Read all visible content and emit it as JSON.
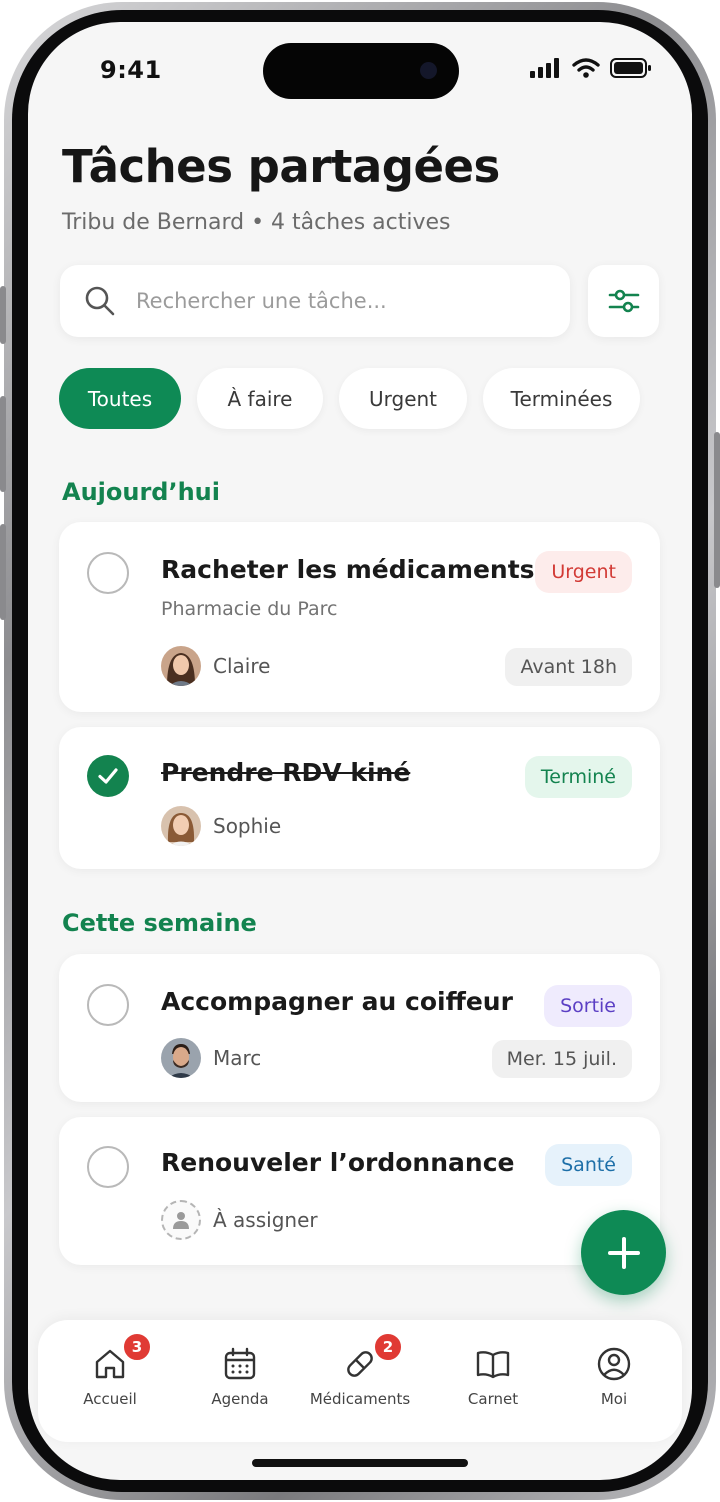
{
  "status": {
    "time": "9:41"
  },
  "header": {
    "title": "Tâches partagées",
    "subtitle": "Tribu de Bernard • 4 tâches actives"
  },
  "search": {
    "placeholder": "Rechercher une tâche..."
  },
  "filters": [
    "Toutes",
    "À faire",
    "Urgent",
    "Terminées"
  ],
  "sections": {
    "today": "Aujourd’hui",
    "week": "Cette semaine"
  },
  "tasks": [
    {
      "title": "Racheter les médicaments",
      "subtitle": "Pharmacie du Parc",
      "badge": "Urgent",
      "badge_color": "#d23a35",
      "badge_bg": "#fdeceb",
      "assignee": "Claire",
      "due": "Avant 18h",
      "done": false
    },
    {
      "title": "Prendre RDV kiné",
      "badge": "Terminé",
      "badge_color": "#13834f",
      "badge_bg": "#e4f6ec",
      "assignee": "Sophie",
      "done": true
    },
    {
      "title": "Accompagner au coiffeur",
      "badge": "Sortie",
      "badge_color": "#5b3fc4",
      "badge_bg": "#efebfd",
      "assignee": "Marc",
      "due": "Mer. 15 juil.",
      "done": false
    },
    {
      "title": "Renouveler l’ordonnance",
      "badge": "Santé",
      "badge_color": "#1d6fa8",
      "badge_bg": "#e6f2fb",
      "assignee": "À assigner",
      "done": false
    }
  ],
  "tabbar": {
    "items": [
      {
        "label": "Accueil",
        "icon": "home-icon",
        "badge": "3"
      },
      {
        "label": "Agenda",
        "icon": "calendar-icon"
      },
      {
        "label": "Médicaments",
        "icon": "pill-icon",
        "badge": "2"
      },
      {
        "label": "Carnet",
        "icon": "book-icon"
      },
      {
        "label": "Moi",
        "icon": "user-circle-icon"
      }
    ]
  },
  "colors": {
    "accent": "#0e8a55",
    "badge_red": "#e03a34",
    "background": "#f6f6f6"
  }
}
